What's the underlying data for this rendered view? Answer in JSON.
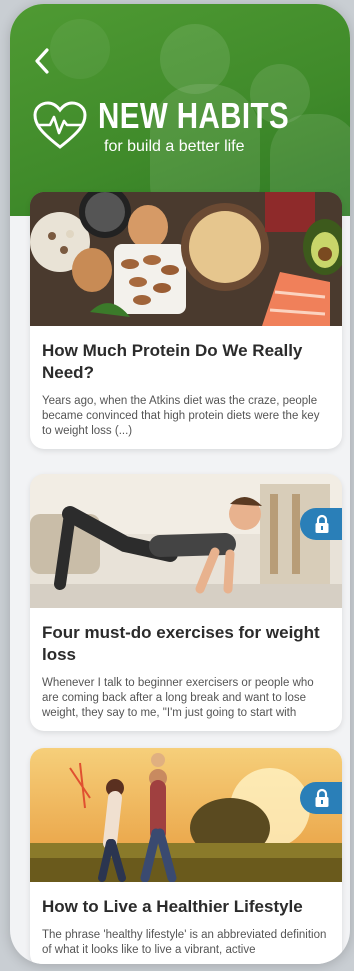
{
  "header": {
    "title": "NEW HABITS",
    "subtitle": "for build a better life",
    "back_icon": "chevron-left-icon",
    "logo_icon": "heart-pulse-icon"
  },
  "colors": {
    "header_green": "#4f9a33",
    "lock_blue": "#2a7fb8",
    "title_text": "#2b2b2b"
  },
  "articles": [
    {
      "title": "How Much Protein Do We Really Need?",
      "excerpt": "Years ago, when the Atkins diet was the craze, people became convinced that high protein diets were the key to weight loss (...)",
      "locked": false,
      "image": "protein-foods-image"
    },
    {
      "title": "Four must-do exercises for weight loss",
      "excerpt": "Whenever I talk to beginner exercisers or people who are coming back after a long break and want to lose weight, they say to me, \"I'm just going to start with",
      "locked": true,
      "image": "woman-exercising-image"
    },
    {
      "title": "How to Live a Healthier Lifestyle",
      "excerpt": "The phrase 'healthy lifestyle' is an abbreviated definition of what it looks like to live a vibrant, active",
      "locked": true,
      "image": "family-outdoors-image"
    }
  ]
}
